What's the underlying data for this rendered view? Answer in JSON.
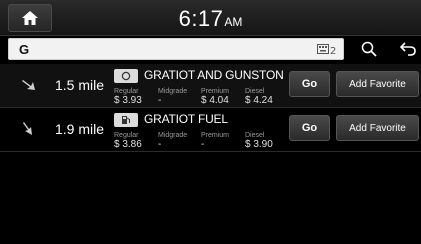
{
  "header": {
    "time": "6:17",
    "ampm": "AM",
    "home_icon": "home-icon"
  },
  "search": {
    "value": "G",
    "keyboard_icon": "keyboard-icon",
    "search_icon": "search-icon",
    "back_icon": "back-icon"
  },
  "results": [
    {
      "distance": "1.5 mile",
      "name": "GRATIOT AND GUNSTON BI",
      "type_icon": "gas-station-icon",
      "prices": [
        {
          "label": "Regular",
          "value": "$ 3.93"
        },
        {
          "label": "Midgrade",
          "value": "-"
        },
        {
          "label": "Premium",
          "value": "$ 4.04"
        },
        {
          "label": "Diesel",
          "value": "$ 4.24"
        }
      ],
      "go_label": "Go",
      "favorite_label": "Add Favorite"
    },
    {
      "distance": "1.9 mile",
      "name": "GRATIOT FUEL",
      "type_icon": "fuel-pump-icon",
      "prices": [
        {
          "label": "Regular",
          "value": "$ 3.86"
        },
        {
          "label": "Midgrade",
          "value": "-"
        },
        {
          "label": "Premium",
          "value": "-"
        },
        {
          "label": "Diesel",
          "value": "$ 3.90"
        }
      ],
      "go_label": "Go",
      "favorite_label": "Add Favorite"
    }
  ]
}
